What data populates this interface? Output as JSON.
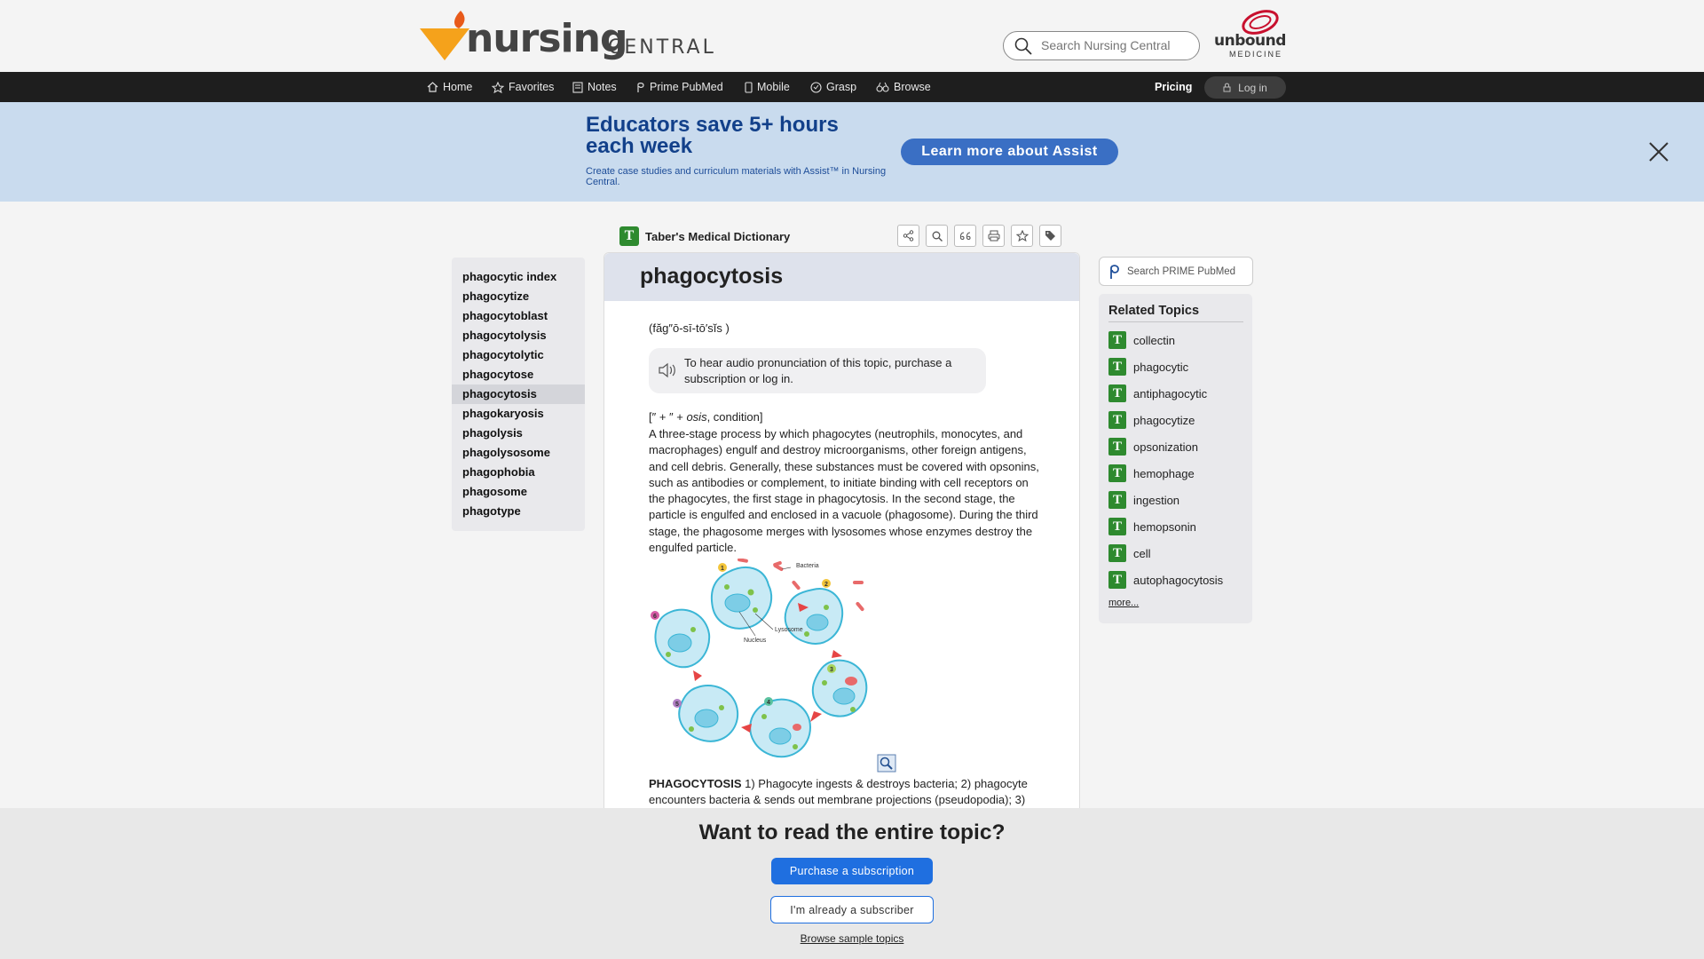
{
  "header": {
    "logo_text": "nursing",
    "logo_text2": "CENTRAL",
    "search_placeholder": "Search Nursing Central",
    "partner_logo_text": "unbound",
    "partner_logo_sub": "MEDICINE"
  },
  "navbar": {
    "items": [
      {
        "label": "Home",
        "icon": "home-icon"
      },
      {
        "label": "Favorites",
        "icon": "star-icon"
      },
      {
        "label": "Notes",
        "icon": "notes-icon"
      },
      {
        "label": "Prime PubMed",
        "icon": "pubmed-icon"
      },
      {
        "label": "Mobile",
        "icon": "mobile-icon"
      },
      {
        "label": "Grasp",
        "icon": "grasp-icon"
      },
      {
        "label": "Browse",
        "icon": "binoculars-icon"
      }
    ],
    "pricing": "Pricing",
    "login": "Log in"
  },
  "banner": {
    "title": "Educators save 5+ hours each week",
    "subtitle": "Create case studies and curriculum materials with Assist™ in Nursing Central.",
    "button": "Learn more about Assist"
  },
  "book": {
    "icon_letter": "T",
    "title": "Taber's Medical Dictionary",
    "tools": [
      "share-icon",
      "search-icon",
      "cite-icon",
      "print-icon",
      "favorite-star-icon",
      "tag-icon"
    ]
  },
  "leftnav": {
    "items": [
      "phagocytic index",
      "phagocytize",
      "phagocytoblast",
      "phagocytolysis",
      "phagocytolytic",
      "phagocytose",
      "phagocytosis",
      "phagokaryosis",
      "phagolysis",
      "phagolysosome",
      "phagophobia",
      "phagosome",
      "phagotype"
    ],
    "active": "phagocytosis"
  },
  "article": {
    "title": "phagocytosis",
    "pronunciation": "(făg″ō-sī-tō′sĭs )",
    "audio_note": "To hear audio pronunciation of this topic, purchase a subscription or log in.",
    "etymology_prefix": "[″ + ″ + ",
    "etymology_term": "osis",
    "etymology_suffix": ", condition]",
    "definition": "A three-stage process by which phagocytes (neutrophils, monocytes, and macrophages) engulf and destroy microorganisms, other foreign antigens, and cell debris. Generally, these substances must be covered with opsonins, such as antibodies or complement, to initiate binding with cell receptors on the phagocytes, the first stage in phagocytosis. In the second stage, the particle is engulfed and enclosed in a vacuole (phagosome). During the third stage, the phagosome merges with lysosomes whose enzymes destroy the engulfed particle.",
    "figure_labels": {
      "bacteria": "Bacteria",
      "lysosome": "Lysosome",
      "nucleus": "Nucleus",
      "steps": [
        "1",
        "2",
        "3",
        "4",
        "5",
        "6"
      ]
    },
    "caption_title": "PHAGOCYTOSIS",
    "caption_text": " 1) Phagocyte ingests & destroys bacteria; 2) phagocyte encounters bacteria & sends out membrane projections (pseudopodia); 3)"
  },
  "sidebar": {
    "pubmed_search": "Search PRIME PubMed",
    "related_title": "Related Topics",
    "related": [
      "collectin",
      "phagocytic",
      "antiphagocytic",
      "phagocytize",
      "opsonization",
      "hemophage",
      "ingestion",
      "hemopsonin",
      "cell",
      "autophagocytosis"
    ],
    "more": "more..."
  },
  "paywall": {
    "heading": "Want to read the entire topic?",
    "buy": "Purchase a subscription",
    "subscriber": "I'm already a subscriber",
    "browse": "Browse sample topics"
  },
  "colors": {
    "banner_bg": "#c9dbee",
    "banner_title": "#12408a",
    "accent_blue": "#1f6fe0",
    "book_green": "#2e8a2f",
    "navbar_bg": "#1e1e1e"
  }
}
